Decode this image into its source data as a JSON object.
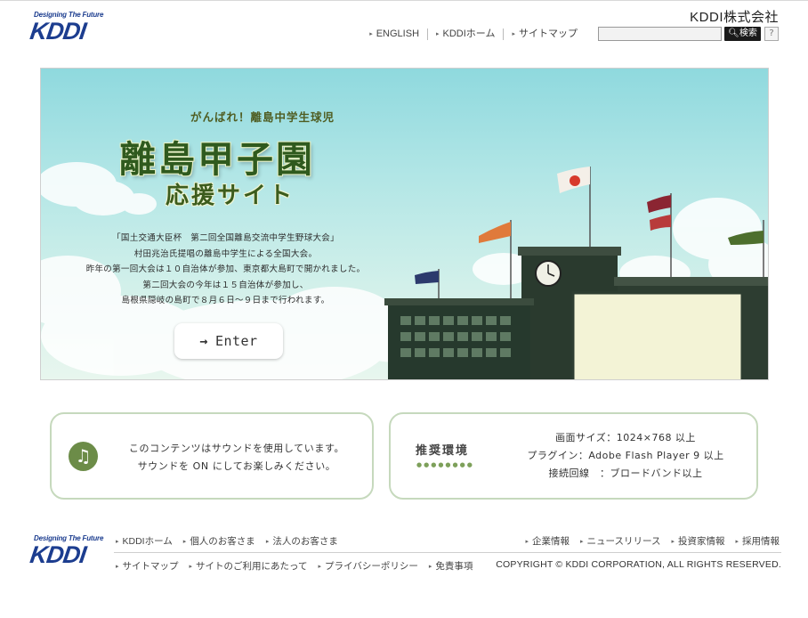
{
  "header": {
    "logo_tagline": "Designing The Future",
    "logo_text": "KDDI",
    "company_name": "KDDI株式会社",
    "nav": [
      {
        "label": "ENGLISH"
      },
      {
        "label": "KDDIホーム"
      },
      {
        "label": "サイトマップ"
      }
    ],
    "search": {
      "value": "",
      "placeholder": "",
      "button_label": "検索",
      "help_label": "?"
    }
  },
  "hero": {
    "subtitle": "がんばれ！離島中学生球児",
    "title": "離島甲子園",
    "title_line2": "応援サイト",
    "description": [
      "「国土交通大臣杯　第二回全国離島交流中学生野球大会」",
      "村田兆治氏提唱の離島中学生による全国大会。",
      "昨年の第一回大会は１０自治体が参加、東京都大島町で開かれました。",
      "第二回大会の今年は１５自治体が参加し、",
      "島根県隠岐の島町で８月６日〜９日まで行われます。"
    ],
    "enter_label": "Enter"
  },
  "sound_notice": {
    "lines": [
      "このコンテンツはサウンドを使用しています。",
      "サウンドを ON にしてお楽しみください。"
    ]
  },
  "environment": {
    "title": "推奨環境",
    "lines": [
      "画面サイズ：1024×768 以上",
      "プラグイン：Adobe Flash Player 9 以上",
      "接続回線　：ブロードバンド以上"
    ]
  },
  "footer": {
    "logo_tagline": "Designing The Future",
    "logo_text": "KDDI",
    "left_top": [
      {
        "label": "KDDIホーム"
      },
      {
        "label": "個人のお客さま"
      },
      {
        "label": "法人のお客さま"
      }
    ],
    "left_bottom": [
      {
        "label": "サイトマップ"
      },
      {
        "label": "サイトのご利用にあたって"
      },
      {
        "label": "プライバシーポリシー"
      },
      {
        "label": "免責事項"
      }
    ],
    "right_top": [
      {
        "label": "企業情報"
      },
      {
        "label": "ニュースリリース"
      },
      {
        "label": "投資家情報"
      },
      {
        "label": "採用情報"
      }
    ],
    "copyright": "COPYRIGHT © KDDI CORPORATION, ALL RIGHTS RESERVED."
  },
  "colors": {
    "brand_blue": "#1c3d8f",
    "title_green": "#2f5a1e",
    "box_border": "#c6d9bd",
    "note_icon_green": "#6c8c48"
  }
}
